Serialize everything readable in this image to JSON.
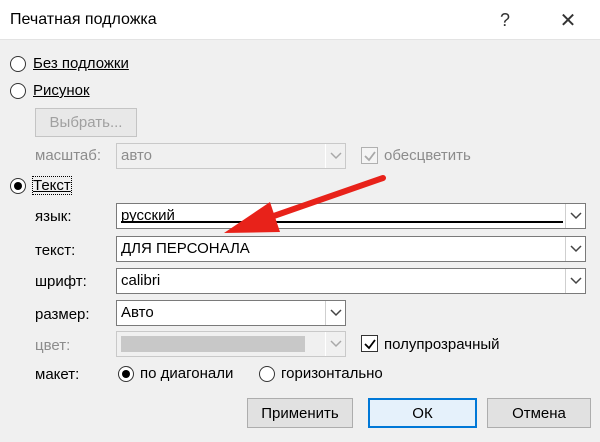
{
  "window": {
    "title": "Печатная подложка",
    "help": "?",
    "close": "✕"
  },
  "options": {
    "no_watermark": "Без подложки",
    "picture": "Рисунок",
    "text": "Текст"
  },
  "picture": {
    "select_button": "Выбрать...",
    "scale_label": "масштаб:",
    "scale_value": "авто",
    "washout_label": "обесцветить"
  },
  "text_section": {
    "language_label": "язык:",
    "language_value": "русский",
    "text_label": "текст:",
    "text_value": "ДЛЯ ПЕРСОНАЛА",
    "font_label": "шрифт:",
    "font_value": "calibri",
    "size_label": "размер:",
    "size_value": "Авто",
    "color_label": "цвет:",
    "semitransparent_label": "полупрозрачный",
    "layout_label": "макет:",
    "diagonal_label": "по диагонали",
    "horizontal_label": "горизонтально"
  },
  "buttons": {
    "apply": "Применить",
    "ok": "ОК",
    "cancel": "Отмена"
  },
  "colors": {
    "annotation_arrow": "#e8221a",
    "accent": "#0078d7",
    "swatch": "#c8c8c8"
  }
}
